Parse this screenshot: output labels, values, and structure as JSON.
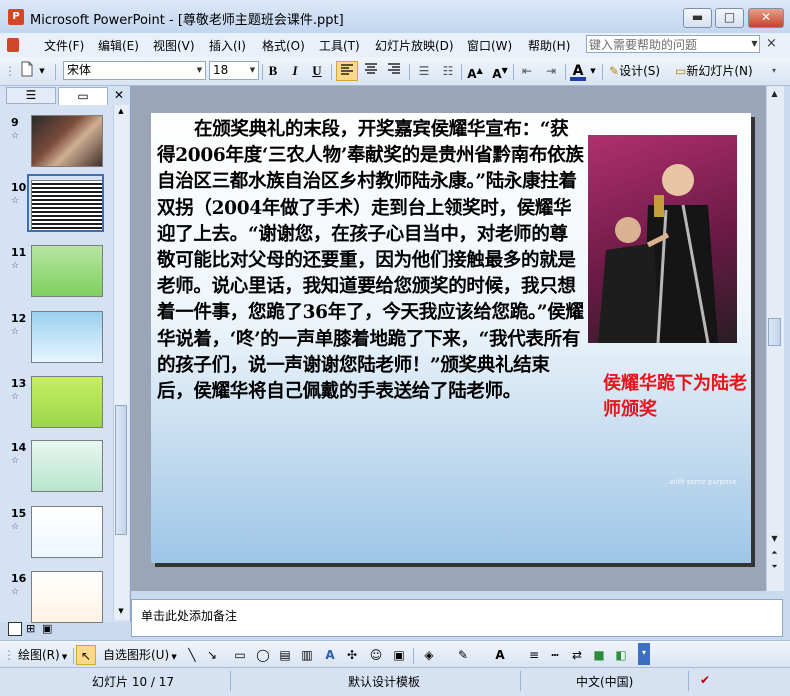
{
  "window": {
    "title": "Microsoft PowerPoint - [尊敬老师主题班会课件.ppt]",
    "minimize": "▬",
    "maximize": "□",
    "close": "✕"
  },
  "menu": {
    "items": [
      "文件(F)",
      "编辑(E)",
      "视图(V)",
      "插入(I)",
      "格式(O)",
      "工具(T)",
      "幻灯片放映(D)",
      "窗口(W)",
      "帮助(H)"
    ],
    "help_placeholder": "键入需要帮助的问题",
    "close": "×"
  },
  "toolbar": {
    "font": "宋体",
    "size": "18",
    "bold": "B",
    "italic": "I",
    "underline": "U",
    "design": "设计(S)",
    "new_slide": "新幻灯片(N)",
    "font_color": "#1e3fa8"
  },
  "thumbnails": [
    {
      "num": "9",
      "style": "photo"
    },
    {
      "num": "10",
      "style": "text-dark"
    },
    {
      "num": "11",
      "style": "green"
    },
    {
      "num": "12",
      "style": "sky"
    },
    {
      "num": "13",
      "style": "lime"
    },
    {
      "num": "14",
      "style": "mint"
    },
    {
      "num": "15",
      "style": "kids"
    },
    {
      "num": "16",
      "style": "plain"
    }
  ],
  "slide": {
    "body": "在颁奖典礼的末段，开奖嘉宾侯耀华宣布：“获得2006年度‘三农人物’奉献奖的是贵州省黔南布依族自治区三都水族自治区乡村教师陆永康。”陆永康拄着双拐（2004年做了手术）走到台上领奖时，侯耀华迎了上去。“谢谢您，在孩子心目当中，对老师的尊敬可能比对父母的还要重，因为他们接触最多的就是老师。说心里话，我知道要给您颁奖的时候，我只想着一件事，您跪了36年了，今天我应该给您跪。”侯耀华说着，‘咚’的一声单膝着地跪了下来，“我代表所有的孩子们，说一声谢谢您陆老师！”颁奖典礼结束后，侯耀华将自己佩戴的手表送给了陆老师。",
    "caption": "侯耀华跪下为陆老师颁奖",
    "watermark": "...with some purpose"
  },
  "notes": {
    "placeholder": "单击此处添加备注"
  },
  "drawbar": {
    "draw": "绘图(R)",
    "autoshapes": "自选图形(U)"
  },
  "status": {
    "slide": "幻灯片 10 / 17",
    "template": "默认设计模板",
    "language": "中文(中国)"
  }
}
